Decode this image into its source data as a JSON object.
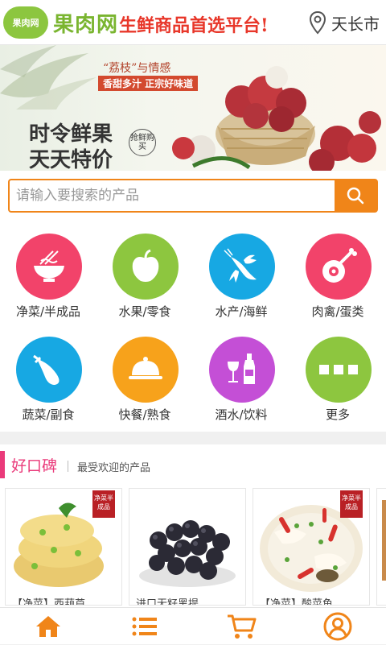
{
  "header": {
    "logo_badge": "果肉网",
    "logo_text": "果肉网",
    "slogan": "生鲜商品首选平台!",
    "city": "天长市"
  },
  "banner": {
    "tag_top": "“荔枝”与情感",
    "tag_red": "香甜多汁  正宗好味道",
    "title_line1": "时令鲜果",
    "title_line2": "天天特价",
    "stamp": "抢鲜购买"
  },
  "search": {
    "placeholder": "请输入要搜索的产品"
  },
  "categories": [
    {
      "label": "净菜/半成品",
      "color": "#f2436a",
      "icon": "noodle-bowl-icon"
    },
    {
      "label": "水果/零食",
      "color": "#8dc63f",
      "icon": "apple-icon"
    },
    {
      "label": "水产/海鲜",
      "color": "#17a8e3",
      "icon": "lobster-icon"
    },
    {
      "label": "肉禽/蛋类",
      "color": "#f2436a",
      "icon": "meat-icon"
    },
    {
      "label": "蔬菜/副食",
      "color": "#17a8e3",
      "icon": "eggplant-icon"
    },
    {
      "label": "快餐/熟食",
      "color": "#f7a21b",
      "icon": "cloche-icon"
    },
    {
      "label": "酒水/饮料",
      "color": "#c44fd6",
      "icon": "wine-icon"
    },
    {
      "label": "更多",
      "color": "#8dc63f",
      "icon": "more-icon"
    }
  ],
  "section": {
    "title": "好口碑",
    "subtitle": "最受欢迎的产品"
  },
  "products": [
    {
      "name": "【净菜】西葫芦",
      "tag": "净菜半成品"
    },
    {
      "name": "进口无籽黑提",
      "tag": ""
    },
    {
      "name": "【净菜】酸菜鱼",
      "tag": "净菜半成品"
    },
    {
      "name": "【",
      "tag": ""
    }
  ],
  "colors": {
    "accent": "#f08519",
    "brand_green": "#7ab530",
    "section_pink": "#ea3a7a"
  }
}
